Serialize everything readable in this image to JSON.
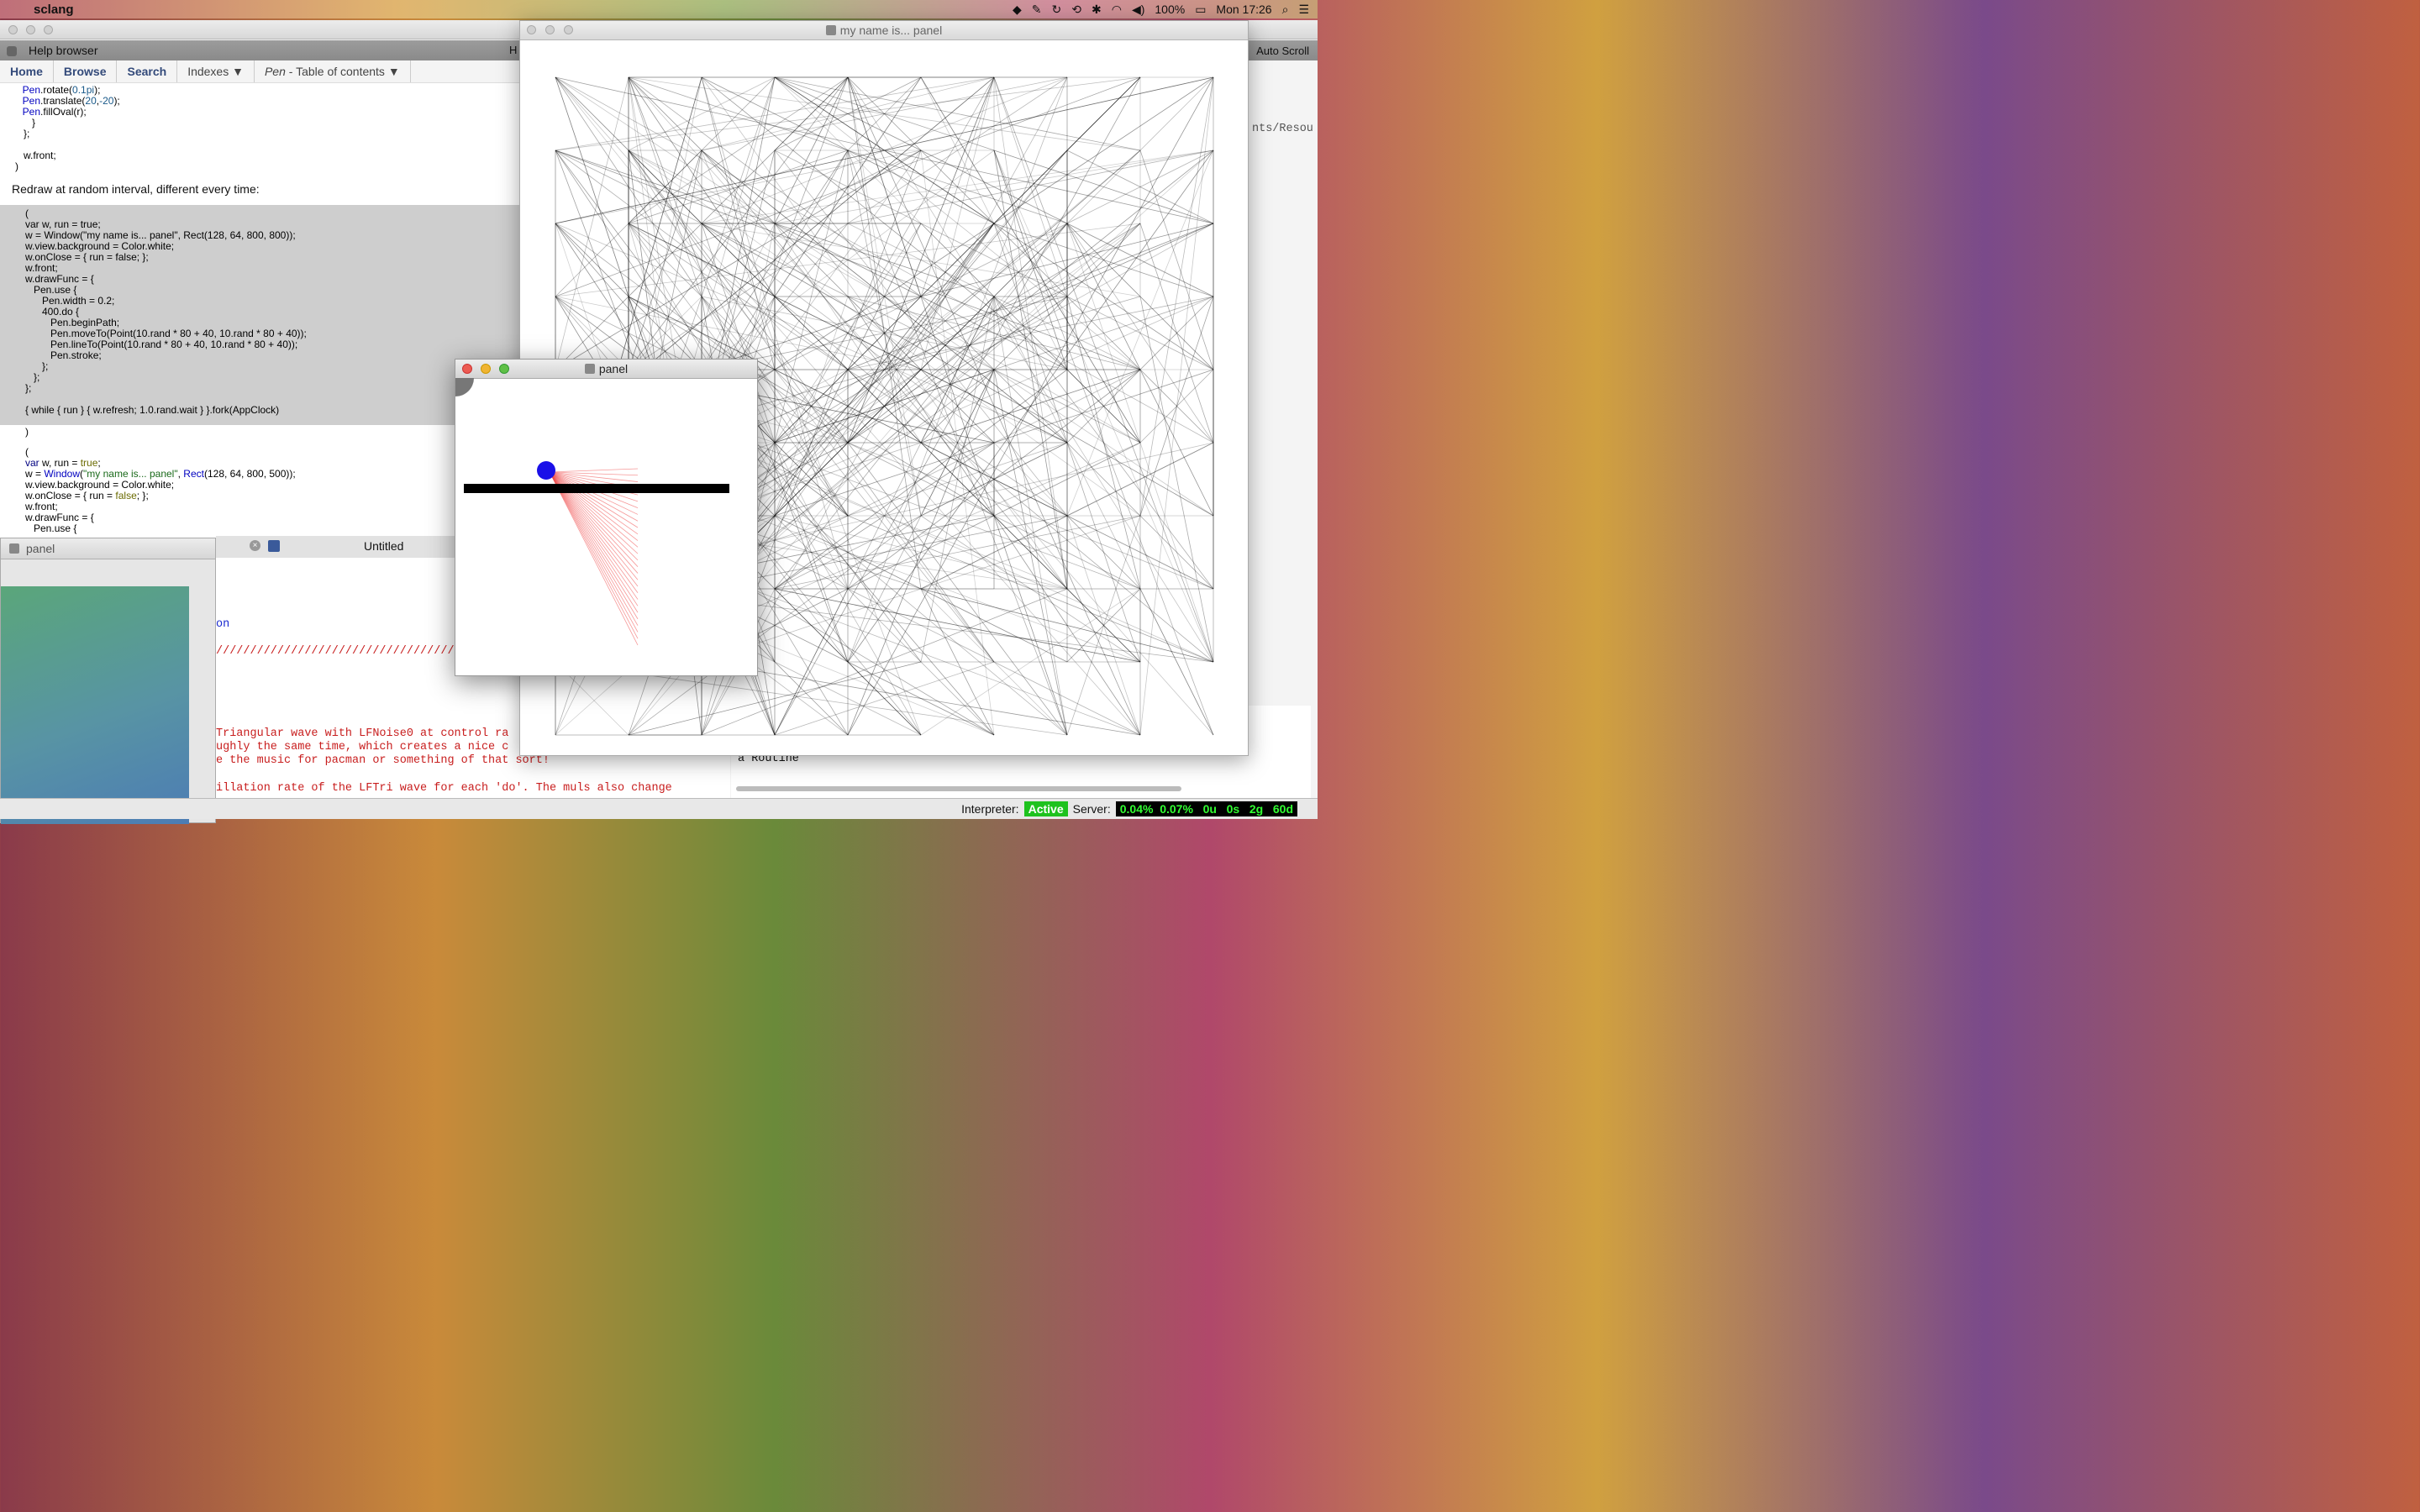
{
  "menubar": {
    "app_name": "sclang",
    "clock": "Mon 17:26",
    "battery": "100%"
  },
  "help": {
    "title": "Help browser",
    "auto_scroll": "Auto Scroll",
    "h_fragment": "H",
    "nav": {
      "home": "Home",
      "browse": "Browse",
      "search": "Search",
      "indexes": "Indexes ▼",
      "pen_em": "Pen",
      "pen_rest": " - Table of contents ▼"
    },
    "doc_line1": "        Pen.rotate(0.1pi);",
    "doc_line2": "        Pen.translate(20,-20);",
    "doc_line3": "        Pen.fillOval(r);",
    "doc_line4": "      }",
    "doc_line5": "   };",
    "doc_line6": "   w.front;",
    "doc_line7": ")",
    "heading": "Redraw at random interval, different every time:",
    "code1": [
      "(",
      "var w, run = true;",
      "w = Window(\"my name is... panel\", Rect(128, 64, 800, 800));",
      "w.view.background = Color.white;",
      "w.onClose = { run = false; };",
      "w.front;",
      "w.drawFunc = {",
      "   Pen.use {",
      "      Pen.width = 0.2;",
      "      400.do {",
      "         Pen.beginPath;",
      "         Pen.moveTo(Point(10.rand * 80 + 40, 10.rand * 80 + 40));",
      "         Pen.lineTo(Point(10.rand * 80 + 40, 10.rand * 80 + 40));",
      "         Pen.stroke;",
      "      };",
      "   };",
      "};",
      "",
      "{ while { run } { w.refresh; 1.0.rand.wait } }.fork(AppClock)",
      "",
      ")"
    ],
    "code2": {
      "l1": "(",
      "l2a": "var",
      "l2b": " w, run = ",
      "l2c": "true",
      "l2d": ";",
      "l3a": "w = ",
      "l3b": "Window",
      "l3c": "(",
      "l3d": "\"my name is... panel\"",
      "l3e": ", ",
      "l3f": "Rect",
      "l3g": "(128, 64, 800, 500));",
      "l4": "w.view.background = Color.white;",
      "l5a": "w.onClose = { run = ",
      "l5b": "false",
      "l5c": "; };",
      "l6": "w.front;",
      "l7": "w.drawFunc = {",
      "l8": "   Pen.use {"
    }
  },
  "panel_small": {
    "title": "panel"
  },
  "editor": {
    "tab_title": "Untitled",
    "lines": [
      "on",
      "//////////////////////////////////////",
      "Triangular wave with LFNoise0 at control ra",
      "ughly the same time, which creates a nice c",
      "e the music for pacman or something of that sort!",
      "illation rate of the LFTri wave for each 'do'. The muls also change"
    ]
  },
  "post": {
    "routine": "a Routine",
    "path_fragment": "nts/Resou"
  },
  "status": {
    "interpreter_label": "Interpreter:",
    "interpreter_state": "Active",
    "server_label": "Server:",
    "cpu1": "0.04%",
    "cpu2": "0.07%",
    "u": "0u",
    "s": "0s",
    "g": "2g",
    "d": "60d"
  },
  "bigwin": {
    "title": "my name is... panel"
  },
  "panelwin": {
    "title": "panel"
  }
}
